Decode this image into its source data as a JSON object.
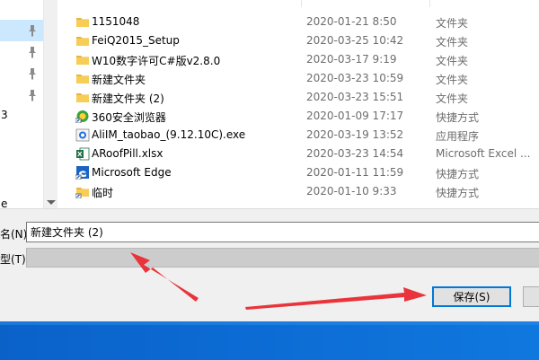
{
  "nav_pane": {
    "fragments": [
      "3",
      "e"
    ]
  },
  "files": [
    {
      "name": "1151048",
      "date": "2020-01-21 8:50",
      "type": "文件夹",
      "icon": "folder-icon"
    },
    {
      "name": "FeiQ2015_Setup",
      "date": "2020-03-25 10:42",
      "type": "文件夹",
      "icon": "folder-icon"
    },
    {
      "name": "W10数字许可C#版v2.8.0",
      "date": "2020-03-17 9:19",
      "type": "文件夹",
      "icon": "folder-icon"
    },
    {
      "name": "新建文件夹",
      "date": "2020-03-23 10:59",
      "type": "文件夹",
      "icon": "folder-icon"
    },
    {
      "name": "新建文件夹 (2)",
      "date": "2020-03-23 15:51",
      "type": "文件夹",
      "icon": "folder-icon"
    },
    {
      "name": "360安全浏览器",
      "date": "2020-01-09 17:17",
      "type": "快捷方式",
      "icon": "browser-shortcut-icon"
    },
    {
      "name": "AliIM_taobao_(9.12.10C).exe",
      "date": "2020-03-19 13:52",
      "type": "应用程序",
      "icon": "application-icon"
    },
    {
      "name": "ARoofPill.xlsx",
      "date": "2020-03-23 14:54",
      "type": "Microsoft Excel ...",
      "icon": "excel-file-icon"
    },
    {
      "name": "Microsoft Edge",
      "date": "2020-01-11 11:59",
      "type": "快捷方式",
      "icon": "edge-shortcut-icon"
    },
    {
      "name": "临时",
      "date": "2020-01-10 9:33",
      "type": "快捷方式",
      "icon": "folder-shortcut-icon"
    }
  ],
  "form": {
    "filename_label": "名(N):",
    "filename_value": "新建文件夹 (2)",
    "savetype_label": "型(T):"
  },
  "buttons": {
    "save_label": "保存(S)"
  },
  "colors": {
    "selection": "#cce8ff",
    "accent": "#0078d7",
    "annotation_arrow": "#e8343a",
    "taskbar": "#0c6ad3"
  }
}
